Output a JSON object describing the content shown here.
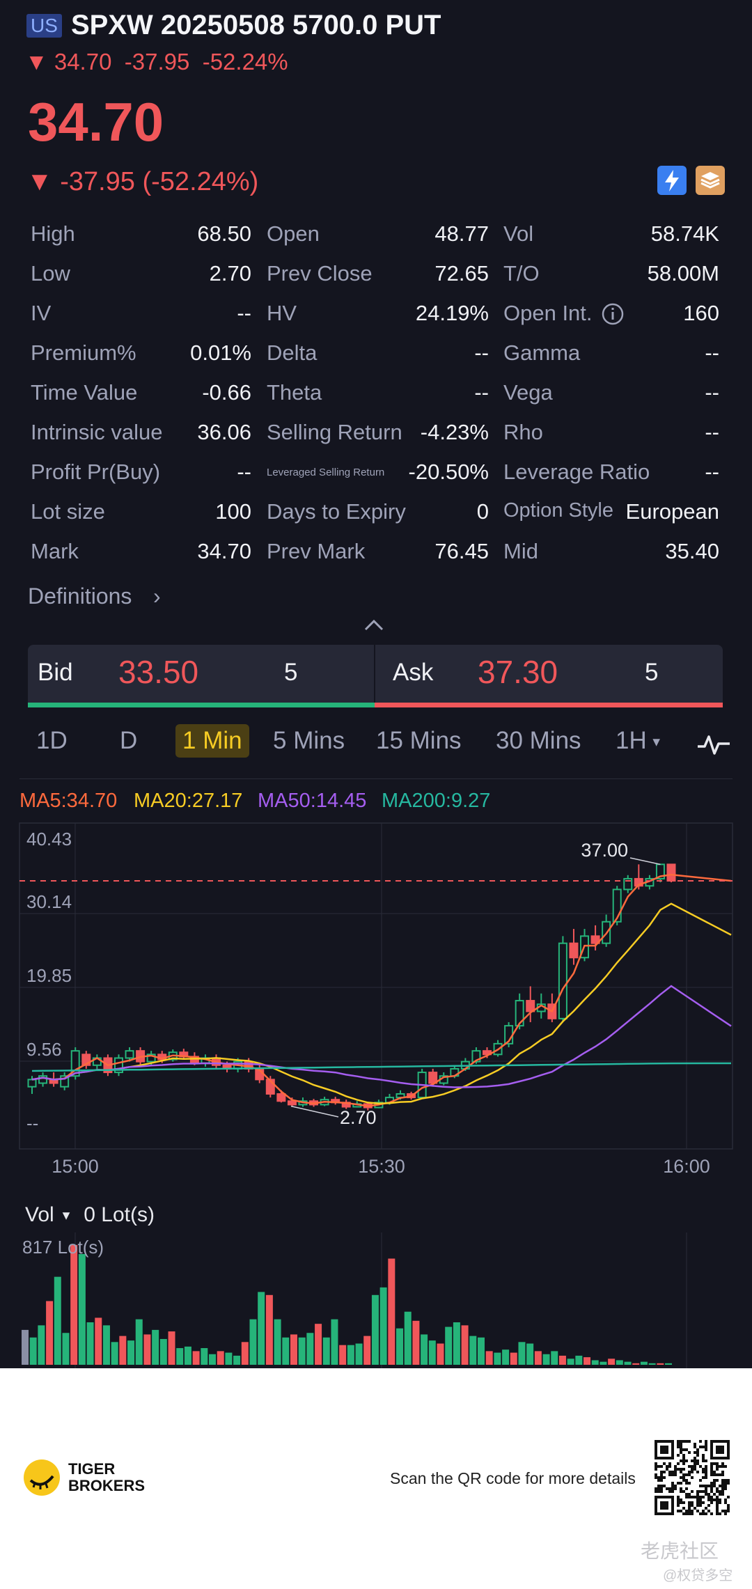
{
  "header": {
    "market_badge": "US",
    "title": "SPXW 20250508 5700.0 PUT",
    "sub_price": "34.70",
    "sub_change": "-37.95",
    "sub_change_pct": "-52.24%",
    "price": "34.70",
    "change_line": "-37.95 (-52.24%)",
    "down_arrow": "▼"
  },
  "stats": [
    [
      [
        "High",
        "68.50"
      ],
      [
        "Open",
        "48.77"
      ],
      [
        "Vol",
        "58.74K"
      ]
    ],
    [
      [
        "Low",
        "2.70"
      ],
      [
        "Prev Close",
        "72.65"
      ],
      [
        "T/O",
        "58.00M"
      ]
    ],
    [
      [
        "IV",
        "--"
      ],
      [
        "HV",
        "24.19%"
      ],
      [
        "Open Int.",
        "160"
      ]
    ],
    [
      [
        "Premium%",
        "0.01%"
      ],
      [
        "Delta",
        "--"
      ],
      [
        "Gamma",
        "--"
      ]
    ],
    [
      [
        "Time Value",
        "-0.66"
      ],
      [
        "Theta",
        "--"
      ],
      [
        "Vega",
        "--"
      ]
    ],
    [
      [
        "Intrinsic value",
        "36.06"
      ],
      [
        "Selling Return",
        "-4.23%"
      ],
      [
        "Rho",
        "--"
      ]
    ],
    [
      [
        "Profit Pr(Buy)",
        "--"
      ],
      [
        "Leveraged Selling Return",
        "-20.50%"
      ],
      [
        "Leverage Ratio",
        "--"
      ]
    ],
    [
      [
        "Lot size",
        "100"
      ],
      [
        "Days to Expiry",
        "0"
      ],
      [
        "Option Style",
        "European"
      ]
    ],
    [
      [
        "Mark",
        "34.70"
      ],
      [
        "Prev Mark",
        "76.45"
      ],
      [
        "Mid",
        "35.40"
      ]
    ]
  ],
  "definitions_label": "Definitions",
  "chevron": "›",
  "bid": {
    "label": "Bid",
    "price": "33.50",
    "size": "5"
  },
  "ask": {
    "label": "Ask",
    "price": "37.30",
    "size": "5"
  },
  "tabs": [
    "1D",
    "D",
    "1 Min",
    "5 Mins",
    "15 Mins",
    "30 Mins",
    "1H"
  ],
  "tabs_active": 2,
  "ma": {
    "ma5": "MA5:34.70",
    "ma20": "MA20:27.17",
    "ma50": "MA50:14.45",
    "ma200": "MA200:9.27",
    "colors": {
      "ma5": "#ff6a3d",
      "ma20": "#f7cc24",
      "ma50": "#a55ef0",
      "ma200": "#26b8a0"
    }
  },
  "chart_data": [
    {
      "type": "candlestick",
      "y_tick_labels": [
        "40.43",
        "30.14",
        "19.85",
        "9.56",
        "--"
      ],
      "x_tick_labels": [
        "15:00",
        "15:30",
        "16:00"
      ],
      "ylim": [
        -0.73,
        40.43
      ],
      "annotation_high": "37.00",
      "annotation_low": "2.70",
      "last_price_line": 34.7,
      "colors": {
        "up": "#26b47a",
        "down": "#f0575a"
      },
      "candles": [
        [
          6,
          7,
          5,
          7.5
        ],
        [
          6.5,
          7.5,
          6,
          8
        ],
        [
          7,
          6.5,
          6,
          8
        ],
        [
          6,
          7.5,
          5.5,
          8
        ],
        [
          7.5,
          11,
          7,
          11.5
        ],
        [
          10.5,
          9,
          8.5,
          11
        ],
        [
          9,
          10,
          8.5,
          10.5
        ],
        [
          10,
          8,
          7.5,
          10.5
        ],
        [
          8,
          10,
          7.5,
          10.5
        ],
        [
          10,
          11,
          9.5,
          11.5
        ],
        [
          11,
          9.5,
          9,
          11.5
        ],
        [
          9.5,
          10.5,
          9,
          11
        ],
        [
          10.5,
          9.8,
          9.3,
          11
        ],
        [
          9.8,
          10.8,
          9.5,
          11.2
        ],
        [
          10.8,
          10.2,
          9.8,
          11.3
        ],
        [
          10.2,
          9.3,
          9,
          10.8
        ],
        [
          9.3,
          10,
          8.8,
          10.5
        ],
        [
          10,
          9,
          8.5,
          10.5
        ],
        [
          9,
          8.5,
          8,
          9.5
        ],
        [
          8.5,
          9.5,
          8,
          10
        ],
        [
          9.5,
          8.5,
          8,
          10
        ],
        [
          8.5,
          7,
          6.5,
          9
        ],
        [
          7,
          5,
          4.5,
          7.5
        ],
        [
          5,
          4,
          3.8,
          5.5
        ],
        [
          4,
          3.5,
          3.2,
          4.5
        ],
        [
          3.5,
          4,
          3.2,
          4.5
        ],
        [
          4,
          3.5,
          3.2,
          4.3
        ],
        [
          3.5,
          4.2,
          3.3,
          4.6
        ],
        [
          4.2,
          3.8,
          3.5,
          4.6
        ],
        [
          3.8,
          3.2,
          2.9,
          4.2
        ],
        [
          3.2,
          3.6,
          3.1,
          4
        ],
        [
          3.6,
          3.1,
          2.7,
          3.9
        ],
        [
          3.1,
          3.8,
          3,
          4.2
        ],
        [
          3.8,
          4.5,
          3.5,
          5
        ],
        [
          4.5,
          5,
          4.2,
          5.5
        ],
        [
          5,
          4.5,
          4.2,
          5.3
        ],
        [
          4.5,
          8,
          4.3,
          8.5
        ],
        [
          8,
          6.5,
          6,
          8.5
        ],
        [
          6.5,
          7.5,
          6.2,
          8
        ],
        [
          7.5,
          8.5,
          7.2,
          9
        ],
        [
          8.5,
          9.5,
          8.2,
          10
        ],
        [
          9.5,
          11,
          9.2,
          11.5
        ],
        [
          11,
          10.5,
          10,
          11.5
        ],
        [
          10.5,
          12,
          10.2,
          12.5
        ],
        [
          12,
          14.5,
          11.5,
          15
        ],
        [
          14.5,
          18,
          14,
          19
        ],
        [
          18,
          16.5,
          15,
          20
        ],
        [
          16.5,
          17.5,
          15.5,
          19
        ],
        [
          17.5,
          15.5,
          15,
          19
        ],
        [
          15.5,
          26,
          15,
          27
        ],
        [
          26,
          24,
          23,
          28
        ],
        [
          24,
          27,
          23.5,
          28
        ],
        [
          27,
          26,
          25,
          28.5
        ],
        [
          26,
          29,
          25.5,
          30
        ],
        [
          29,
          33.5,
          28.5,
          34
        ],
        [
          33.5,
          35,
          33,
          35.5
        ],
        [
          35,
          34,
          33.5,
          37
        ],
        [
          34,
          35,
          33.5,
          35.5
        ],
        [
          35,
          37,
          34.5,
          37
        ],
        [
          37,
          34.7,
          34.5,
          37
        ]
      ]
    },
    {
      "type": "bar",
      "title": "Vol",
      "value_label": "0 Lot(s)",
      "max_label": "817 Lot(s)",
      "values": [
        230,
        180,
        260,
        420,
        580,
        210,
        790,
        730,
        280,
        310,
        260,
        150,
        190,
        160,
        300,
        200,
        230,
        170,
        220,
        110,
        120,
        90,
        110,
        70,
        90,
        80,
        60,
        150,
        300,
        480,
        460,
        300,
        180,
        200,
        180,
        210,
        270,
        180,
        300,
        130,
        130,
        140,
        190,
        460,
        510,
        700,
        240,
        350,
        290,
        200,
        160,
        140,
        250,
        280,
        260,
        190,
        180,
        90,
        80,
        100,
        80,
        150,
        140,
        90,
        70,
        90,
        60,
        40,
        60,
        50,
        30,
        20,
        40,
        30,
        20,
        10,
        20,
        10,
        10,
        10
      ]
    }
  ],
  "footer": {
    "brand_line1": "TIGER",
    "brand_line2": "BROKERS",
    "scan_text": "Scan the QR code for more details",
    "watermark1": "老虎社区",
    "watermark2": "@权贷多空"
  }
}
